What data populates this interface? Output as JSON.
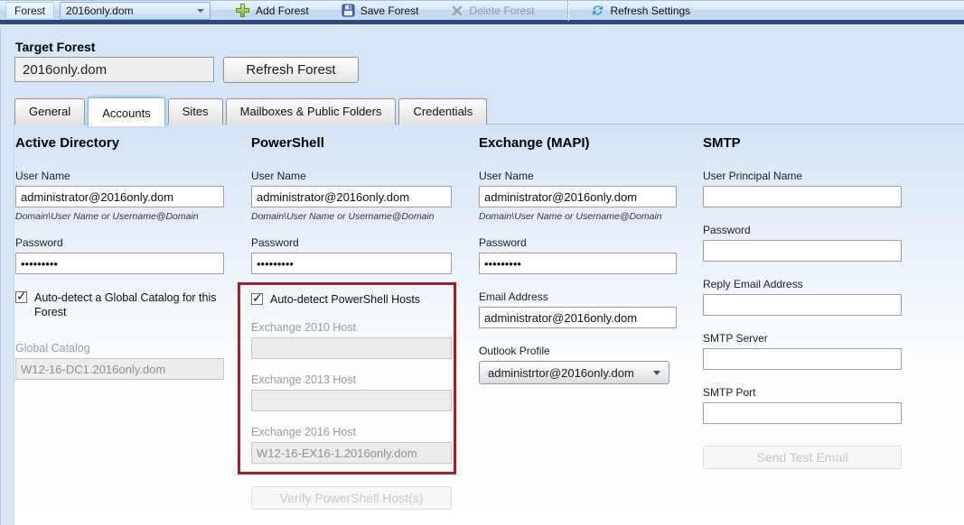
{
  "toolbar": {
    "forest_label": "Forest",
    "forest_dropdown_value": "2016only.dom",
    "add_forest_label": "Add Forest",
    "save_forest_label": "Save Forest",
    "delete_forest_label": "Delete Forest",
    "refresh_settings_label": "Refresh Settings",
    "icons": [
      "plus-icon",
      "floppy-save-icon",
      "x-delete-icon",
      "refresh-icon",
      "chevron-down-icon"
    ]
  },
  "target_forest": {
    "label": "Target Forest",
    "value": "2016only.dom",
    "refresh_button_label": "Refresh Forest"
  },
  "tabs": [
    {
      "label": "General",
      "active": false
    },
    {
      "label": "Accounts",
      "active": true
    },
    {
      "label": "Sites",
      "active": false
    },
    {
      "label": "Mailboxes & Public Folders",
      "active": false
    },
    {
      "label": "Credentials",
      "active": false
    }
  ],
  "accounts": {
    "active_directory": {
      "heading": "Active Directory",
      "user_name_label": "User Name",
      "user_name_value": "administrator@2016only.dom",
      "user_name_hint": "Domain\\User Name or Username@Domain",
      "password_label": "Password",
      "password_value": "•••••••••",
      "auto_detect_label": "Auto-detect a Global Catalog for this Forest",
      "auto_detect_checked": true,
      "global_catalog_label": "Global Catalog",
      "global_catalog_value": "W12-16-DC1.2016only.dom"
    },
    "powershell": {
      "heading": "PowerShell",
      "user_name_label": "User Name",
      "user_name_value": "administrator@2016only.dom",
      "user_name_hint": "Domain\\User Name or Username@Domain",
      "password_label": "Password",
      "password_value": "•••••••••",
      "auto_detect_label": "Auto-detect PowerShell Hosts",
      "auto_detect_checked": true,
      "exchange_2010_label": "Exchange 2010 Host",
      "exchange_2010_value": "",
      "exchange_2013_label": "Exchange 2013 Host",
      "exchange_2013_value": "",
      "exchange_2016_label": "Exchange 2016 Host",
      "exchange_2016_value": "W12-16-EX16-1.2016only.dom",
      "verify_button_label": "Verify PowerShell Host(s)",
      "highlight_border_color": "#a61e1e"
    },
    "exchange_mapi": {
      "heading": "Exchange (MAPI)",
      "user_name_label": "User Name",
      "user_name_value": "administrator@2016only.dom",
      "user_name_hint": "Domain\\User Name or Username@Domain",
      "password_label": "Password",
      "password_value": "•••••••••",
      "email_address_label": "Email Address",
      "email_address_value": "administrator@2016only.dom",
      "outlook_profile_label": "Outlook Profile",
      "outlook_profile_value": "administrtor@2016only.dom"
    },
    "smtp": {
      "heading": "SMTP",
      "upn_label": "User Principal Name",
      "upn_value": "",
      "password_label": "Password",
      "password_value": "",
      "reply_email_label": "Reply Email Address",
      "reply_email_value": "",
      "smtp_server_label": "SMTP Server",
      "smtp_server_value": "",
      "smtp_port_label": "SMTP Port",
      "smtp_port_value": "",
      "send_test_button_label": "Send Test Email"
    }
  },
  "colors": {
    "toolbar_bottom_strip": "#30497b",
    "highlight_box_red": "#a61e1e",
    "add_icon_green": "#7ab82e",
    "refresh_icon_blue": "#2e9ad8",
    "panel_background_blue": "#d3e3f5"
  }
}
